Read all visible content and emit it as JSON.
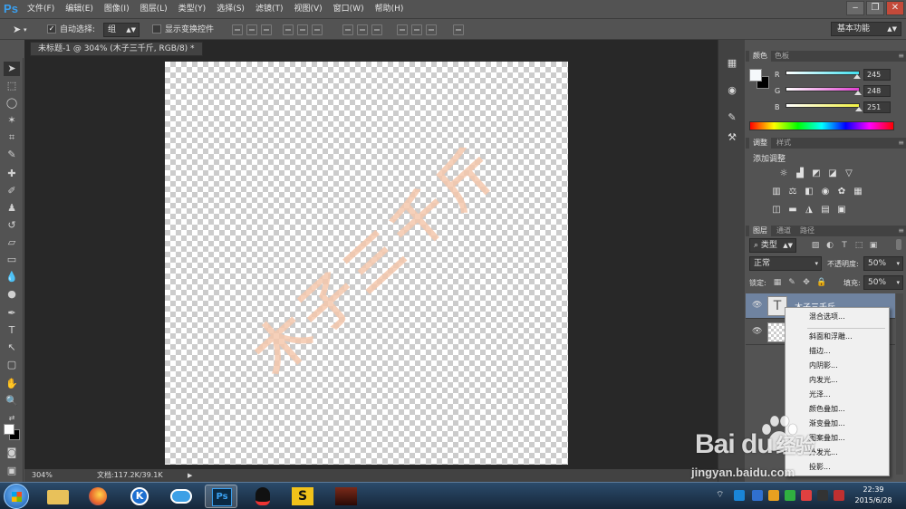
{
  "app": {
    "logo": "Ps",
    "menu": [
      "文件(F)",
      "编辑(E)",
      "图像(I)",
      "图层(L)",
      "类型(Y)",
      "选择(S)",
      "滤镜(T)",
      "视图(V)",
      "窗口(W)",
      "帮助(H)"
    ],
    "window_controls": [
      "‒",
      "❐",
      "✕"
    ]
  },
  "options_bar": {
    "auto_select_label": "自动选择:",
    "auto_select_checked": true,
    "group_value": "组",
    "show_transform_label": "显示变换控件",
    "show_transform_checked": false,
    "workspace_value": "基本功能"
  },
  "document": {
    "tab_title": "未标题-1 @ 304% (木子三千斤, RGB/8) *",
    "watermark_text": "木子三千斤",
    "zoom": "304%",
    "doc_info": "文档:117.2K/39.1K"
  },
  "color_panel": {
    "tabs": [
      "颜色",
      "色板"
    ],
    "r_label": "R",
    "g_label": "G",
    "b_label": "B",
    "r_value": "245",
    "g_value": "248",
    "b_value": "251",
    "r_fraction": 0.961,
    "g_fraction": 0.973,
    "b_fraction": 0.984,
    "r_color": "#40e0f0",
    "g_color": "#e040d0",
    "b_color": "#f0f040"
  },
  "adjustments_panel": {
    "tabs": [
      "调整",
      "样式"
    ],
    "title": "添加调整"
  },
  "layers_panel": {
    "tabs": [
      "图层",
      "通道",
      "路径"
    ],
    "filter_kind": "类型",
    "blend_mode": "正常",
    "opacity_label": "不透明度:",
    "opacity_value": "50%",
    "lock_label": "锁定:",
    "fill_label": "填充:",
    "fill_value": "50%",
    "layers": [
      {
        "name": "木子三千斤",
        "type": "text",
        "selected": true
      },
      {
        "name": "",
        "type": "pixel",
        "selected": false
      }
    ]
  },
  "context_menu": {
    "items": [
      "混合选项...",
      "斜面和浮雕...",
      "描边...",
      "内阴影...",
      "内发光...",
      "光泽...",
      "颜色叠加...",
      "渐变叠加...",
      "图案叠加...",
      "外发光...",
      "投影..."
    ]
  },
  "taskbar": {
    "time": "22:39",
    "date": "2015/6/28"
  },
  "watermark": {
    "brand": "Bai du",
    "brand_suffix": "经验",
    "url": "jingyan.baidu.com"
  },
  "colors": {
    "ui_bg": "#535353",
    "canvas_bg": "#282828",
    "selected_layer": "#6f83a0",
    "watermark_text": "#f5c8ad"
  }
}
